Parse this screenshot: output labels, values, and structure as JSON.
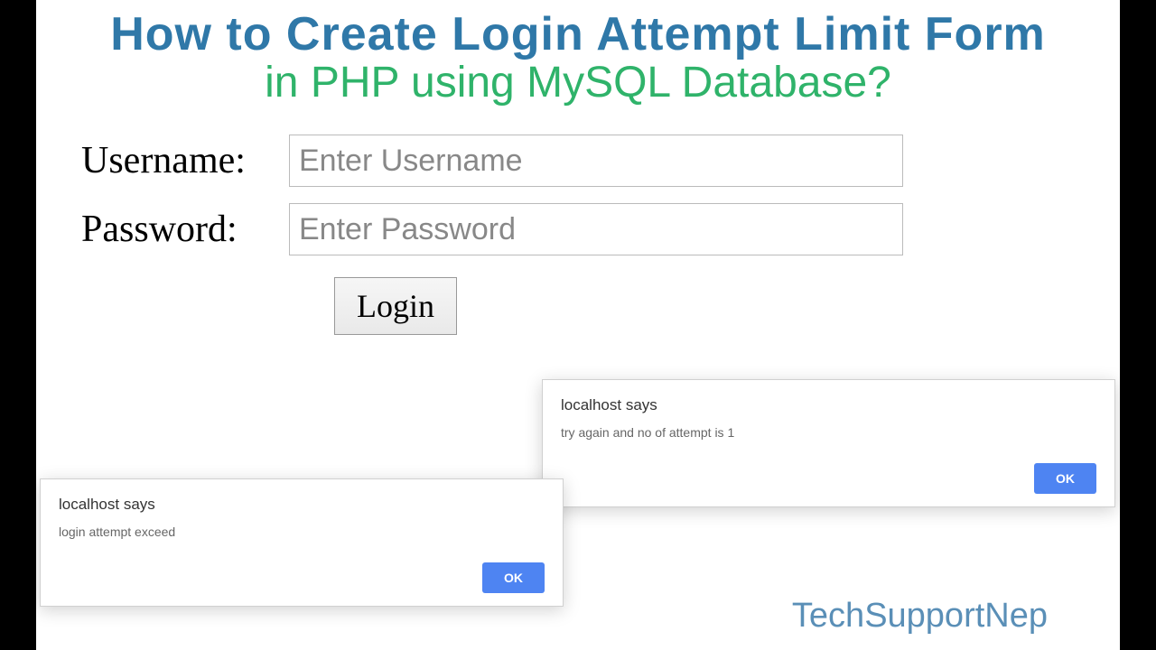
{
  "title": {
    "line1": "How to Create Login Attempt Limit Form",
    "line2": "in PHP using MySQL Database?"
  },
  "form": {
    "username_label": "Username:",
    "username_placeholder": "Enter Username",
    "password_label": "Password:",
    "password_placeholder": "Enter Password",
    "login_label": "Login"
  },
  "dialog_a": {
    "title": "localhost says",
    "message": "try again and no of attempt is 1",
    "ok": "OK"
  },
  "dialog_b": {
    "title": "localhost says",
    "message": "login attempt exceed",
    "ok": "OK"
  },
  "brand": "TechSupportNep"
}
